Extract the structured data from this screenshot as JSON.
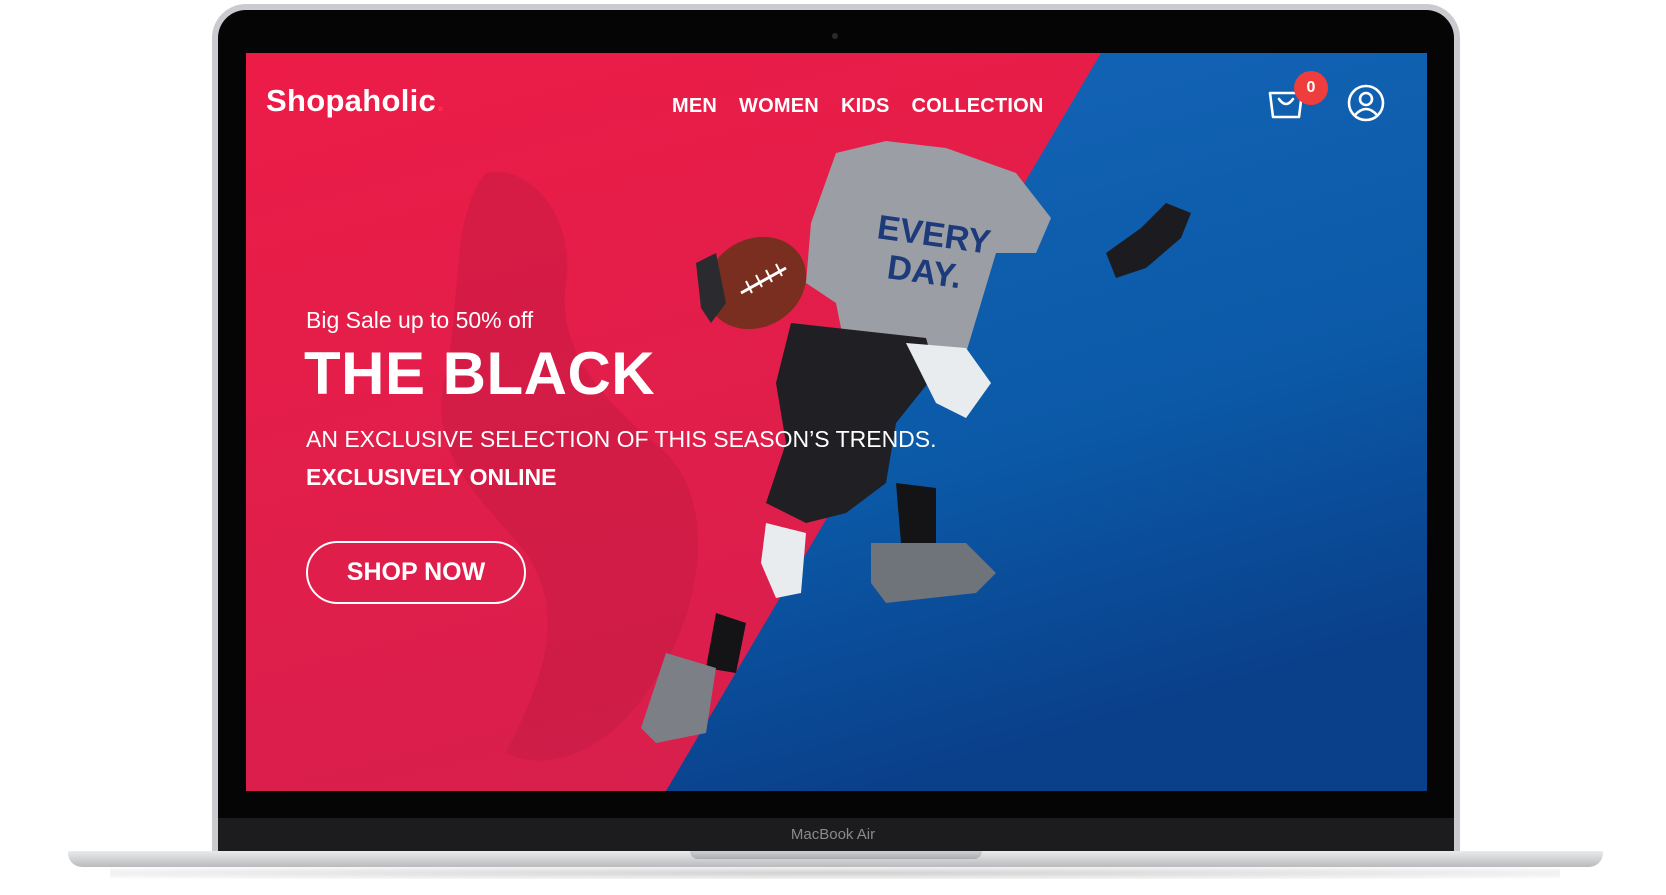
{
  "device": {
    "label": "MacBook Air"
  },
  "header": {
    "logo": "Shopaholic",
    "logo_dot": ".",
    "nav": [
      "MEN",
      "WOMEN",
      "KIDS",
      "COLLECTION"
    ],
    "cart_count": "0"
  },
  "hero": {
    "subtitle": "Big Sale up to 50% off",
    "title": "THE BLACK",
    "description": "AN EXCLUSIVE SELECTION OF THIS SEASON’S TRENDS.",
    "tagline": "EXCLUSIVELY ONLINE",
    "cta": "SHOP NOW",
    "shirt_text_1": "EVERY",
    "shirt_text_2": "DAY."
  },
  "colors": {
    "red_panel": "#e21f4d",
    "blue_panel": "#0b63b4",
    "badge": "#ef3d3d"
  },
  "icons": [
    "cart-icon",
    "user-icon"
  ]
}
